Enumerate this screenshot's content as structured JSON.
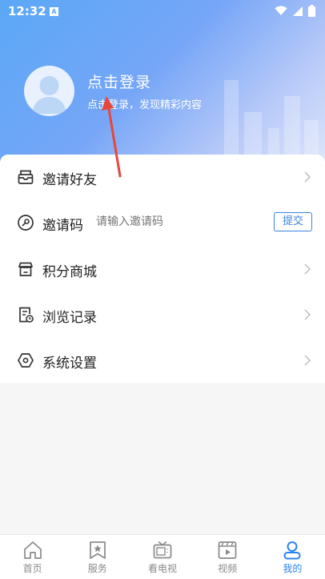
{
  "status_bar": {
    "time": "12:32",
    "indicator": "A"
  },
  "profile": {
    "login_title": "点击登录",
    "login_subtitle": "点击登录，发现精彩内容"
  },
  "menu": {
    "invite_friends": "邀请好友",
    "invite_code": "邀请码",
    "invite_code_placeholder": "请输入邀请码",
    "submit_label": "提交",
    "points_mall": "积分商城",
    "browse_history": "浏览记录",
    "system_settings": "系统设置"
  },
  "bottom_nav": {
    "items": [
      {
        "label": "首页",
        "icon": "home-icon"
      },
      {
        "label": "服务",
        "icon": "star-bookmark-icon"
      },
      {
        "label": "看电视",
        "icon": "tv-icon"
      },
      {
        "label": "视频",
        "icon": "video-icon"
      },
      {
        "label": "我的",
        "icon": "user-icon"
      }
    ],
    "active_index": 4
  },
  "colors": {
    "accent": "#2b83f0",
    "header_gradient_start": "#5aa8f7",
    "arrow": "#e8463b"
  }
}
